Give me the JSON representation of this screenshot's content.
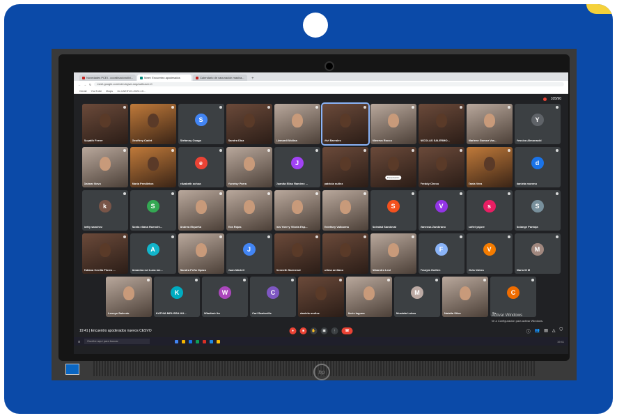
{
  "browser": {
    "tabs": [
      {
        "label": "Novedades PCEI - coordinacionolivi..."
      },
      {
        "label": "Meet: Encuentro apoderados"
      },
      {
        "label": "Calendario de vacunación masiva..."
      }
    ],
    "url": "meet.google.com/vdm-bgwe-sng/authuser=0",
    "bookmarks": [
      "Gmail",
      "YouTube",
      "Maps",
      "11-CAESVO-2022-10..."
    ]
  },
  "meeting": {
    "participant_count": "105/90",
    "rows": [
      [
        {
          "name": "Suyatih Ferrer",
          "type": "video",
          "tone": "dark"
        },
        {
          "name": "Geoffrey Cadet",
          "type": "video",
          "tone": "warm"
        },
        {
          "name": "Stefanny Ocaga",
          "type": "avatar",
          "initial": "S",
          "color": "#4285f4"
        },
        {
          "name": "Sandra Diaz",
          "type": "video",
          "tone": "dark"
        },
        {
          "name": "Lizmardi Molina",
          "type": "video",
          "tone": "light"
        },
        {
          "name": "Vivi Barrales",
          "type": "video",
          "tone": "dark",
          "speaking": true
        },
        {
          "name": "Minerva Rocco",
          "type": "video",
          "tone": "light"
        },
        {
          "name": "NICOLAS SALERMO...",
          "type": "video",
          "tone": "dark"
        },
        {
          "name": "Marlene Gomez Vas...",
          "type": "video",
          "tone": "light"
        },
        {
          "name": "Yessica Almonacid",
          "type": "avatar",
          "initial": "Y",
          "color": "#5f6368"
        }
      ],
      [
        {
          "name": "Dalmar Nevo",
          "type": "video",
          "tone": "light"
        },
        {
          "name": "Maria Pendleton",
          "type": "video",
          "tone": "warm"
        },
        {
          "name": "elizabeth ochoa",
          "type": "avatar",
          "initial": "e",
          "color": "#ea4335"
        },
        {
          "name": "Yuneisy Parra",
          "type": "video",
          "tone": "light"
        },
        {
          "name": "Juanita Elias Ramirez ...",
          "type": "avatar",
          "initial": "J",
          "color": "#a142f4"
        },
        {
          "name": "patricia nuñez",
          "type": "video",
          "tone": "dark"
        },
        {
          "name": "Presentación",
          "type": "video",
          "tone": "dark",
          "pill": "Presentación"
        },
        {
          "name": "Freddy Checo",
          "type": "video",
          "tone": "dark"
        },
        {
          "name": "Tania Vera",
          "type": "video",
          "tone": "warm"
        },
        {
          "name": "daniela moreno",
          "type": "avatar",
          "initial": "d",
          "color": "#1a73e8"
        }
      ],
      [
        {
          "name": "betty sanchez",
          "type": "avatar",
          "initial": "k",
          "color": "#795548"
        },
        {
          "name": "Sonia eliana Huenchi...",
          "type": "avatar",
          "initial": "S",
          "color": "#34a853"
        },
        {
          "name": "Andrea Elqueña",
          "type": "video",
          "tone": "light"
        },
        {
          "name": "Eva Rojas",
          "type": "video",
          "tone": "light"
        },
        {
          "name": "Isis Yoerry Viloria Esp...",
          "type": "video",
          "tone": "light"
        },
        {
          "name": "Estefany Valbuena",
          "type": "video",
          "tone": "light"
        },
        {
          "name": "Soledad Sandoval",
          "type": "avatar",
          "initial": "S",
          "color": "#f4511e"
        },
        {
          "name": "Vanessa Zambrano",
          "type": "avatar",
          "initial": "V",
          "color": "#9334e6"
        },
        {
          "name": "sofiel yajure",
          "type": "avatar",
          "initial": "s",
          "color": "#e91e63"
        },
        {
          "name": "Solange Pantoja",
          "type": "avatar",
          "initial": "S",
          "color": "#78909c"
        }
      ],
      [
        {
          "name": "Tatiana Cecilia Flores ...",
          "type": "video",
          "tone": "dark"
        },
        {
          "name": "Amanina rut Luna me...",
          "type": "avatar",
          "initial": "A",
          "color": "#12b5cb"
        },
        {
          "name": "Sandra Peña Opazo",
          "type": "video",
          "tone": "light"
        },
        {
          "name": "Juan Martell",
          "type": "avatar",
          "initial": "J",
          "color": "#4285f4"
        },
        {
          "name": "Kenneth Sarmenal",
          "type": "video",
          "tone": "dark"
        },
        {
          "name": "wilma arellano",
          "type": "video",
          "tone": "dark"
        },
        {
          "name": "Nibandra Leal",
          "type": "video",
          "tone": "light"
        },
        {
          "name": "Franyia Guillen",
          "type": "avatar",
          "initial": "F",
          "color": "#8ab4f8"
        },
        {
          "name": "Vivia Valera",
          "type": "avatar",
          "initial": "V",
          "color": "#f57c00"
        },
        {
          "name": "Mario M M",
          "type": "avatar",
          "initial": "M",
          "color": "#a1887f"
        }
      ],
      [
        {
          "name": "Lennys Salcedo",
          "type": "video",
          "tone": "light"
        },
        {
          "name": "KATHIA MELISSA HU...",
          "type": "avatar",
          "initial": "K",
          "color": "#00acc1"
        },
        {
          "name": "Wladimir Ita",
          "type": "avatar",
          "initial": "W",
          "color": "#ab47bc"
        },
        {
          "name": "Carl Santoville",
          "type": "avatar",
          "initial": "C",
          "color": "#7e57c2"
        },
        {
          "name": "daniela muñoz",
          "type": "video",
          "tone": "dark"
        },
        {
          "name": "Ibrés laguna",
          "type": "video",
          "tone": "light"
        },
        {
          "name": "Mustafa Lobos",
          "type": "avatar",
          "initial": "M",
          "color": "#bcaaa4"
        },
        {
          "name": "Natalia Silva",
          "type": "video",
          "tone": "light"
        },
        {
          "name": "Tú",
          "type": "avatar",
          "initial": "C",
          "color": "#ef6c00"
        }
      ]
    ],
    "time": "19:41",
    "title": "Encuentro apoderados nuevos CESVO",
    "activate_title": "Activar Windows",
    "activate_sub": "Ve a Configuración para activar Windows."
  },
  "taskbar": {
    "search_placeholder": "Escribe aquí para buscar",
    "clock": "19:41"
  },
  "colors": {
    "card_bg": "#0b4aa8",
    "accent": "#f5d13a",
    "meet_bg": "#202124"
  }
}
